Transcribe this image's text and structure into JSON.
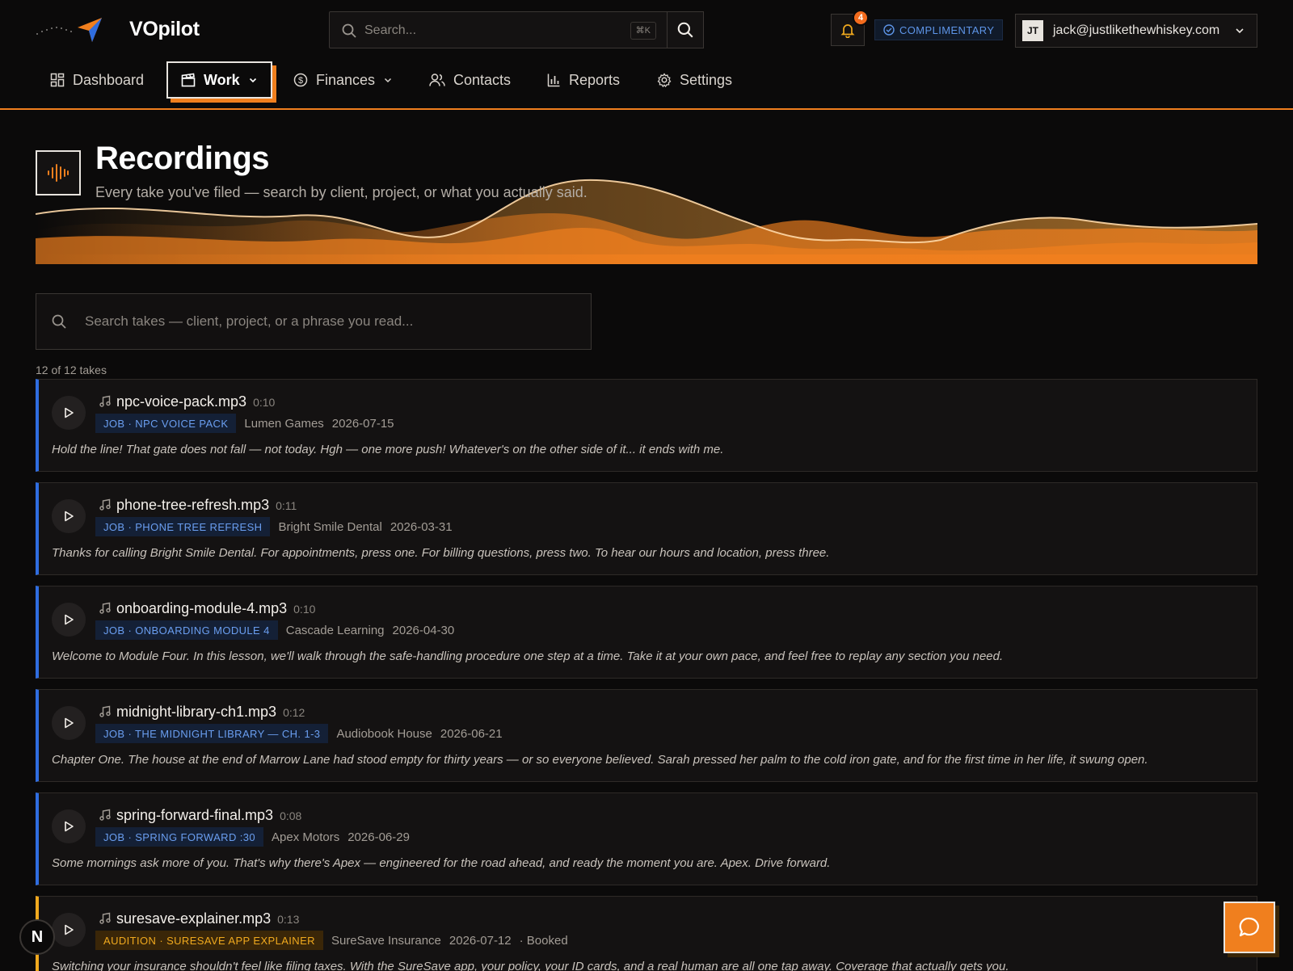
{
  "header": {
    "brand": "VOpilot",
    "search_placeholder": "Search...",
    "search_shortcut": "⌘K",
    "notification_count": "4",
    "plan_badge": "COMPLIMENTARY",
    "avatar_initials": "JT",
    "account_email": "jack@justlikethewhiskey.com"
  },
  "nav": {
    "items": [
      {
        "label": "Dashboard",
        "icon": "dashboard-grid-icon"
      },
      {
        "label": "Work",
        "icon": "clapperboard-icon",
        "active": true,
        "dropdown": true
      },
      {
        "label": "Finances",
        "icon": "dollar-coin-icon",
        "dropdown": true
      },
      {
        "label": "Contacts",
        "icon": "users-icon"
      },
      {
        "label": "Reports",
        "icon": "bar-chart-icon"
      },
      {
        "label": "Settings",
        "icon": "gear-icon"
      }
    ]
  },
  "page": {
    "title": "Recordings",
    "subtitle": "Every take you've filed — search by client, project, or what you actually said.",
    "search_placeholder": "Search takes — client, project, or a phrase you read...",
    "count_label": "12 of 12 takes"
  },
  "takes": [
    {
      "file": "npc-voice-pack.mp3",
      "duration": "0:10",
      "tag": "JOB · NPC VOICE PACK",
      "type": "job",
      "client": "Lumen Games",
      "date": "2026-07-15",
      "status": "",
      "transcript": "Hold the line! That gate does not fall — not today. Hgh — one more push! Whatever's on the other side of it... it ends with me."
    },
    {
      "file": "phone-tree-refresh.mp3",
      "duration": "0:11",
      "tag": "JOB · PHONE TREE REFRESH",
      "type": "job",
      "client": "Bright Smile Dental",
      "date": "2026-03-31",
      "status": "",
      "transcript": "Thanks for calling Bright Smile Dental. For appointments, press one. For billing questions, press two. To hear our hours and location, press three."
    },
    {
      "file": "onboarding-module-4.mp3",
      "duration": "0:10",
      "tag": "JOB · ONBOARDING MODULE 4",
      "type": "job",
      "client": "Cascade Learning",
      "date": "2026-04-30",
      "status": "",
      "transcript": "Welcome to Module Four. In this lesson, we'll walk through the safe-handling procedure one step at a time. Take it at your own pace, and feel free to replay any section you need."
    },
    {
      "file": "midnight-library-ch1.mp3",
      "duration": "0:12",
      "tag": "JOB · THE MIDNIGHT LIBRARY — CH. 1-3",
      "type": "job",
      "client": "Audiobook House",
      "date": "2026-06-21",
      "status": "",
      "transcript": "Chapter One. The house at the end of Marrow Lane had stood empty for thirty years — or so everyone believed. Sarah pressed her palm to the cold iron gate, and for the first time in her life, it swung open."
    },
    {
      "file": "spring-forward-final.mp3",
      "duration": "0:08",
      "tag": "JOB · SPRING FORWARD :30",
      "type": "job",
      "client": "Apex Motors",
      "date": "2026-06-29",
      "status": "",
      "transcript": "Some mornings ask more of you. That's why there's Apex — engineered for the road ahead, and ready the moment you are. Apex. Drive forward."
    },
    {
      "file": "suresave-explainer.mp3",
      "duration": "0:13",
      "tag": "AUDITION · SURESAVE APP EXPLAINER",
      "type": "audition",
      "client": "SureSave Insurance",
      "date": "2026-07-12",
      "status": "· Booked",
      "transcript": "Switching your insurance shouldn't feel like filing taxes. With the SureSave app, your policy, your ID cards, and a real human are all one tap away. Coverage that actually gets you."
    }
  ],
  "floating": {
    "n_badge": "N",
    "chat_icon": "chat-bubble-icon"
  },
  "colors": {
    "accent": "#f07f1e",
    "job_tag": "#6a9ef0",
    "audition_tag": "#f0a91e",
    "background": "#0b0a0a"
  }
}
